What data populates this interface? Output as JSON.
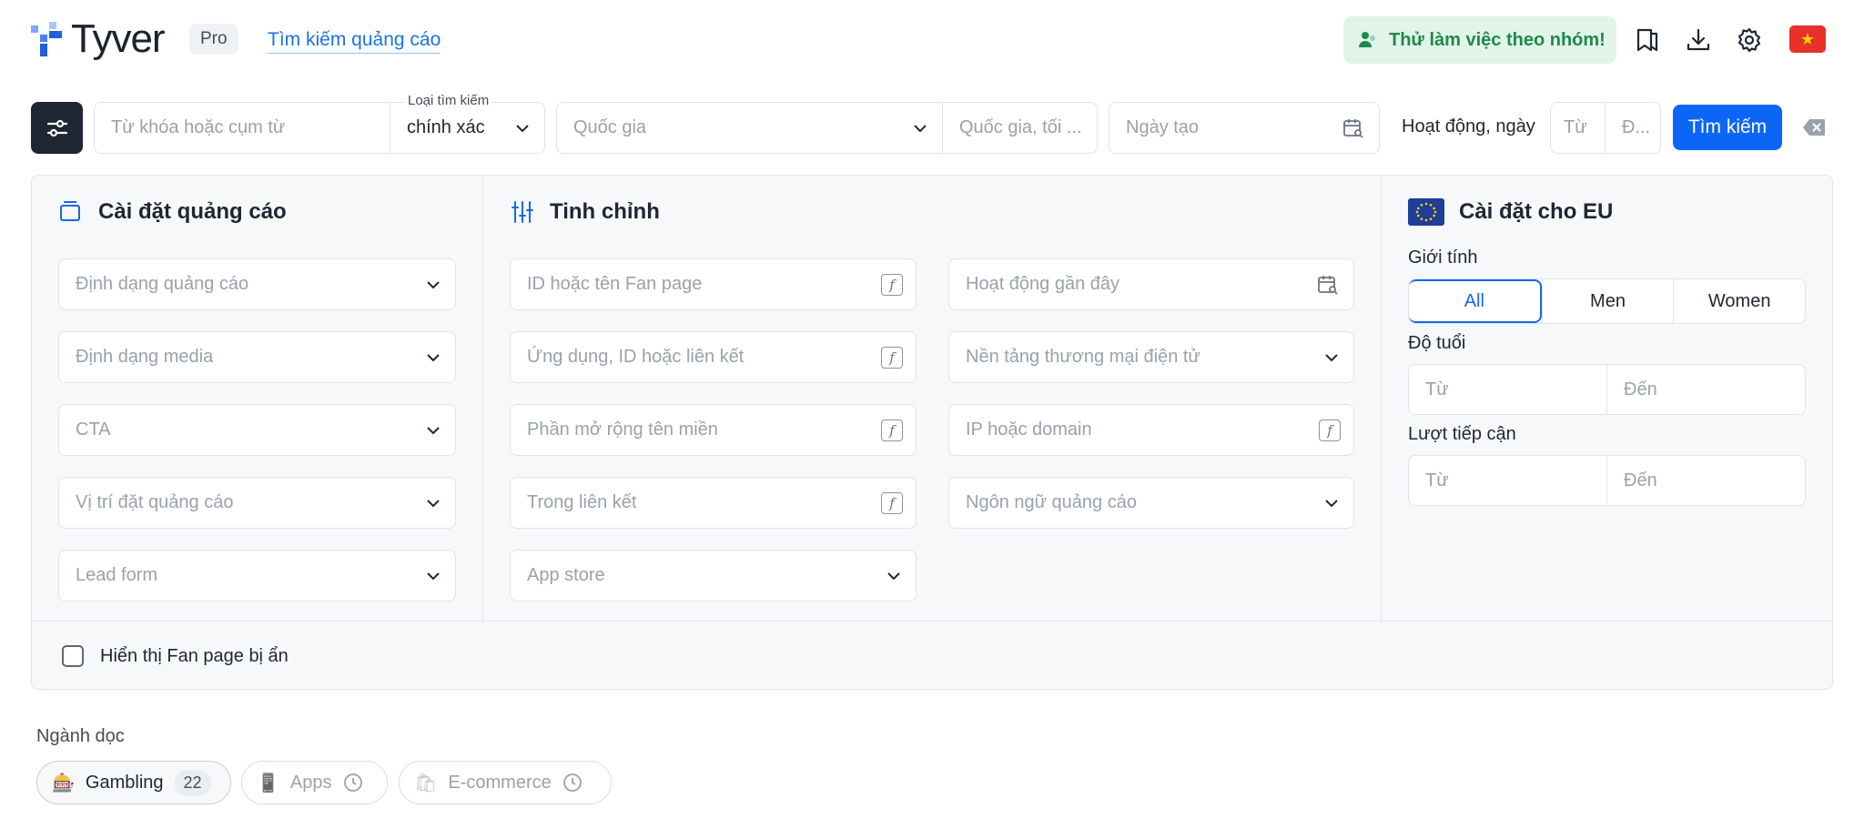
{
  "header": {
    "logo_text": "Tyver",
    "badge": "Pro",
    "nav_link": "Tìm kiếm quảng cáo",
    "team_button": "Thử làm việc theo nhóm!",
    "icons": [
      "bookmarks-icon",
      "download-icon",
      "gear-icon",
      "vietnam-flag-icon"
    ]
  },
  "search": {
    "keyword_placeholder": "Từ khóa hoặc cụm từ",
    "search_type_label": "Loại tìm kiếm",
    "search_type_value": "chính xác",
    "country_placeholder": "Quốc gia",
    "country_extra_placeholder": "Quốc gia, tối ...",
    "created_date_placeholder": "Ngày tạo",
    "active_days_label": "Hoạt động, ngày",
    "active_from": "Từ",
    "active_to": "Đ...",
    "search_button": "Tìm kiếm"
  },
  "ad_settings": {
    "title": "Cài đặt quảng cáo",
    "fields": [
      "Định dạng quảng cáo",
      "Định dạng media",
      "CTA",
      "Vị trí đặt quảng cáo",
      "Lead form"
    ]
  },
  "refine": {
    "title": "Tinh chỉnh",
    "left_fields": [
      "ID hoặc tên Fan page",
      "Ứng dụng, ID hoặc liên kết",
      "Phần mở rộng tên miền",
      "Trong liên kết",
      "App store"
    ],
    "right_fields": [
      "Hoạt động gần đây",
      "Nền tảng thương mại điện tử",
      "IP hoặc domain",
      "Ngôn ngữ quảng cáo"
    ]
  },
  "eu": {
    "title": "Cài đặt cho EU",
    "gender_label": "Giới tính",
    "gender_options": [
      "All",
      "Men",
      "Women"
    ],
    "gender_selected": "All",
    "age_label": "Độ tuổi",
    "age_from": "Từ",
    "age_to": "Đến",
    "reach_label": "Lượt tiếp cận",
    "reach_from": "Từ",
    "reach_to": "Đến"
  },
  "hidden_pages_label": "Hiển thị Fan page bị ẩn",
  "verticals": {
    "label": "Ngành dọc",
    "chips": [
      {
        "emoji": "🎰",
        "name": "Gambling",
        "count": "22"
      },
      {
        "emoji": "📱",
        "name": "Apps"
      },
      {
        "emoji": "🛍",
        "name": "E-commerce"
      }
    ]
  },
  "colors": {
    "accent": "#0b66f6",
    "team_green": "#1d8a4b",
    "dark": "#1f2633"
  }
}
